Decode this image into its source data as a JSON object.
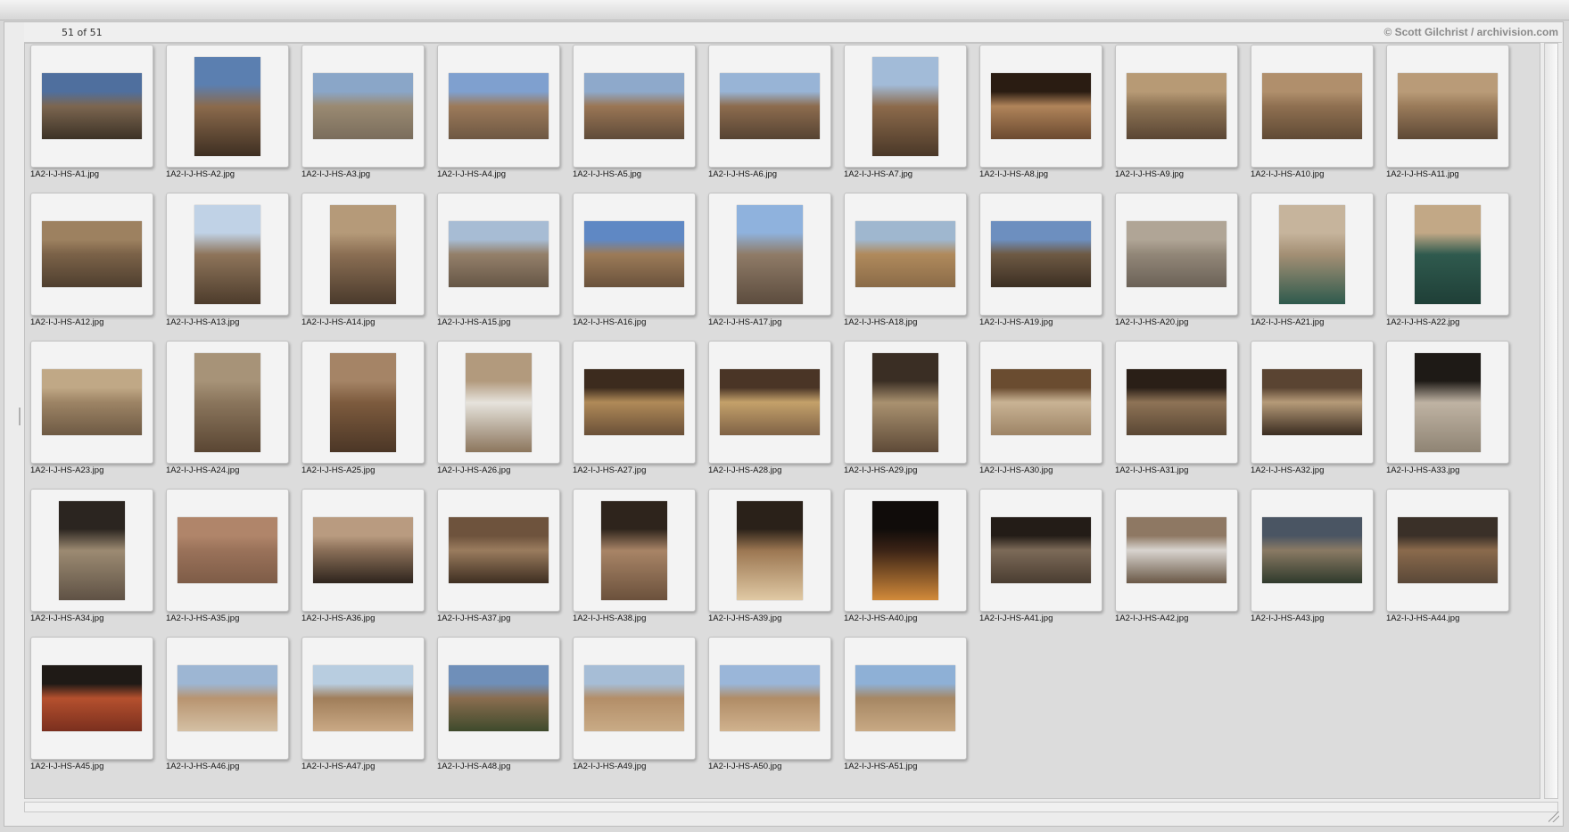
{
  "window": {
    "counter": "51 of 51",
    "copyright": "© Scott Gilchrist / archivision.com"
  },
  "thumbnails": [
    {
      "name": "1A2-I-J-HS-A1.jpg",
      "orientation": "landscape",
      "colors": [
        "#4f6f9e",
        "#7c6650",
        "#3c3226"
      ]
    },
    {
      "name": "1A2-I-J-HS-A2.jpg",
      "orientation": "portrait",
      "colors": [
        "#5b7fb0",
        "#8b6a4c",
        "#3e2f22"
      ]
    },
    {
      "name": "1A2-I-J-HS-A3.jpg",
      "orientation": "landscape",
      "colors": [
        "#8aa6c8",
        "#9a8a72",
        "#7a6d5c"
      ]
    },
    {
      "name": "1A2-I-J-HS-A4.jpg",
      "orientation": "landscape",
      "colors": [
        "#7fa0cf",
        "#9c7a5a",
        "#6e5843"
      ]
    },
    {
      "name": "1A2-I-J-HS-A5.jpg",
      "orientation": "landscape",
      "colors": [
        "#8ea9cb",
        "#9a7655",
        "#5f4b39"
      ]
    },
    {
      "name": "1A2-I-J-HS-A6.jpg",
      "orientation": "landscape",
      "colors": [
        "#98b4d6",
        "#8d6c4e",
        "#564333"
      ]
    },
    {
      "name": "1A2-I-J-HS-A7.jpg",
      "orientation": "portrait",
      "colors": [
        "#a2bbd8",
        "#8c6a4b",
        "#4a3828"
      ]
    },
    {
      "name": "1A2-I-J-HS-A8.jpg",
      "orientation": "landscape",
      "colors": [
        "#2a1c12",
        "#b0845a",
        "#6b4a30"
      ]
    },
    {
      "name": "1A2-I-J-HS-A9.jpg",
      "orientation": "landscape",
      "colors": [
        "#b79a75",
        "#8e7455",
        "#5a4634"
      ]
    },
    {
      "name": "1A2-I-J-HS-A10.jpg",
      "orientation": "landscape",
      "colors": [
        "#b08f6c",
        "#8f7051",
        "#604a35"
      ]
    },
    {
      "name": "1A2-I-J-HS-A11.jpg",
      "orientation": "landscape",
      "colors": [
        "#b99b78",
        "#9a7b5a",
        "#5e4936"
      ]
    },
    {
      "name": "1A2-I-J-HS-A12.jpg",
      "orientation": "landscape",
      "colors": [
        "#9d8160",
        "#7b6248",
        "#4f3f2f"
      ]
    },
    {
      "name": "1A2-I-J-HS-A13.jpg",
      "orientation": "portrait",
      "colors": [
        "#c0d2e6",
        "#8e745a",
        "#4d3c2c"
      ]
    },
    {
      "name": "1A2-I-J-HS-A14.jpg",
      "orientation": "portrait",
      "colors": [
        "#b59a79",
        "#8a6e53",
        "#4a3a2c"
      ]
    },
    {
      "name": "1A2-I-J-HS-A15.jpg",
      "orientation": "landscape",
      "colors": [
        "#a7bcd4",
        "#94806a",
        "#665646"
      ]
    },
    {
      "name": "1A2-I-J-HS-A16.jpg",
      "orientation": "landscape",
      "colors": [
        "#5f88c4",
        "#9c7b58",
        "#6a523c"
      ]
    },
    {
      "name": "1A2-I-J-HS-A17.jpg",
      "orientation": "portrait",
      "colors": [
        "#8fb2dd",
        "#8f7b67",
        "#5c4c3e"
      ]
    },
    {
      "name": "1A2-I-J-HS-A18.jpg",
      "orientation": "landscape",
      "colors": [
        "#9fb7cf",
        "#b08a5c",
        "#8a6b48"
      ]
    },
    {
      "name": "1A2-I-J-HS-A19.jpg",
      "orientation": "landscape",
      "colors": [
        "#6d8fbf",
        "#6e5a44",
        "#3c2f23"
      ]
    },
    {
      "name": "1A2-I-J-HS-A20.jpg",
      "orientation": "landscape",
      "colors": [
        "#b0a596",
        "#928778",
        "#6b6257"
      ]
    },
    {
      "name": "1A2-I-J-HS-A21.jpg",
      "orientation": "portrait",
      "colors": [
        "#c6b49c",
        "#a38f74",
        "#2e5a4d"
      ]
    },
    {
      "name": "1A2-I-J-HS-A22.jpg",
      "orientation": "portrait",
      "colors": [
        "#c2a886",
        "#2f5a4e",
        "#1f3f37"
      ]
    },
    {
      "name": "1A2-I-J-HS-A23.jpg",
      "orientation": "landscape",
      "colors": [
        "#c0a886",
        "#9d8465",
        "#6e5a44"
      ]
    },
    {
      "name": "1A2-I-J-HS-A24.jpg",
      "orientation": "portrait",
      "colors": [
        "#a79378",
        "#8a755c",
        "#5a4633"
      ]
    },
    {
      "name": "1A2-I-J-HS-A25.jpg",
      "orientation": "portrait",
      "colors": [
        "#a58466",
        "#7d5b3e",
        "#4b3626"
      ]
    },
    {
      "name": "1A2-I-J-HS-A26.jpg",
      "orientation": "portrait",
      "colors": [
        "#b29a7d",
        "#e6e3dc",
        "#8c765d"
      ]
    },
    {
      "name": "1A2-I-J-HS-A27.jpg",
      "orientation": "landscape",
      "colors": [
        "#3c2b1e",
        "#b08a58",
        "#6a5038"
      ]
    },
    {
      "name": "1A2-I-J-HS-A28.jpg",
      "orientation": "landscape",
      "colors": [
        "#4a3526",
        "#c4a16a",
        "#7f6246"
      ]
    },
    {
      "name": "1A2-I-J-HS-A29.jpg",
      "orientation": "portrait",
      "colors": [
        "#3a2e24",
        "#a9916f",
        "#5e4a38"
      ]
    },
    {
      "name": "1A2-I-J-HS-A30.jpg",
      "orientation": "landscape",
      "colors": [
        "#6a4c30",
        "#c9b394",
        "#9d8466"
      ]
    },
    {
      "name": "1A2-I-J-HS-A31.jpg",
      "orientation": "landscape",
      "colors": [
        "#2a1f17",
        "#8e7356",
        "#5a4734"
      ]
    },
    {
      "name": "1A2-I-J-HS-A32.jpg",
      "orientation": "landscape",
      "colors": [
        "#5a4432",
        "#b59a78",
        "#3a2c20"
      ]
    },
    {
      "name": "1A2-I-J-HS-A33.jpg",
      "orientation": "portrait",
      "colors": [
        "#1e1a16",
        "#bfb3a3",
        "#8f8474"
      ]
    },
    {
      "name": "1A2-I-J-HS-A34.jpg",
      "orientation": "portrait",
      "colors": [
        "#2b2520",
        "#9c8a72",
        "#5f5245"
      ]
    },
    {
      "name": "1A2-I-J-HS-A35.jpg",
      "orientation": "landscape",
      "colors": [
        "#b0856a",
        "#9a725a",
        "#7e5c47"
      ]
    },
    {
      "name": "1A2-I-J-HS-A36.jpg",
      "orientation": "landscape",
      "colors": [
        "#b99b80",
        "#8a6f58",
        "#2e241d"
      ]
    },
    {
      "name": "1A2-I-J-HS-A37.jpg",
      "orientation": "landscape",
      "colors": [
        "#6e533d",
        "#9a7c5e",
        "#3e2e21"
      ]
    },
    {
      "name": "1A2-I-J-HS-A38.jpg",
      "orientation": "portrait",
      "colors": [
        "#2e241c",
        "#a88466",
        "#6b513c"
      ]
    },
    {
      "name": "1A2-I-J-HS-A39.jpg",
      "orientation": "portrait",
      "colors": [
        "#2a2119",
        "#9c7752",
        "#e0c9a4"
      ]
    },
    {
      "name": "1A2-I-J-HS-A40.jpg",
      "orientation": "portrait",
      "colors": [
        "#100c0a",
        "#3c2416",
        "#d28a3a"
      ]
    },
    {
      "name": "1A2-I-J-HS-A41.jpg",
      "orientation": "landscape",
      "colors": [
        "#231c17",
        "#7c6a58",
        "#4a3d31"
      ]
    },
    {
      "name": "1A2-I-J-HS-A42.jpg",
      "orientation": "landscape",
      "colors": [
        "#8e7863",
        "#d8d4cf",
        "#6a5846"
      ]
    },
    {
      "name": "1A2-I-J-HS-A43.jpg",
      "orientation": "landscape",
      "colors": [
        "#4a5563",
        "#8a7a64",
        "#2f3a2c"
      ]
    },
    {
      "name": "1A2-I-J-HS-A44.jpg",
      "orientation": "landscape",
      "colors": [
        "#3a3028",
        "#8a6a4c",
        "#5a4838"
      ]
    },
    {
      "name": "1A2-I-J-HS-A45.jpg",
      "orientation": "landscape",
      "colors": [
        "#1f1a16",
        "#b5502e",
        "#7a2f1e"
      ]
    },
    {
      "name": "1A2-I-J-HS-A46.jpg",
      "orientation": "landscape",
      "colors": [
        "#9db6d3",
        "#b89470",
        "#d4c0a4"
      ]
    },
    {
      "name": "1A2-I-J-HS-A47.jpg",
      "orientation": "landscape",
      "colors": [
        "#b8cde0",
        "#a07e5a",
        "#caa985"
      ]
    },
    {
      "name": "1A2-I-J-HS-A48.jpg",
      "orientation": "landscape",
      "colors": [
        "#6f8fb9",
        "#8a6d4f",
        "#3e4a2c"
      ]
    },
    {
      "name": "1A2-I-J-HS-A49.jpg",
      "orientation": "landscape",
      "colors": [
        "#a6bdd6",
        "#b38e68",
        "#c9ab86"
      ]
    },
    {
      "name": "1A2-I-J-HS-A50.jpg",
      "orientation": "landscape",
      "colors": [
        "#9ab6d9",
        "#b08c66",
        "#d0b28e"
      ]
    },
    {
      "name": "1A2-I-J-HS-A51.jpg",
      "orientation": "landscape",
      "colors": [
        "#8eb0d6",
        "#a68763",
        "#c8a984"
      ]
    }
  ]
}
